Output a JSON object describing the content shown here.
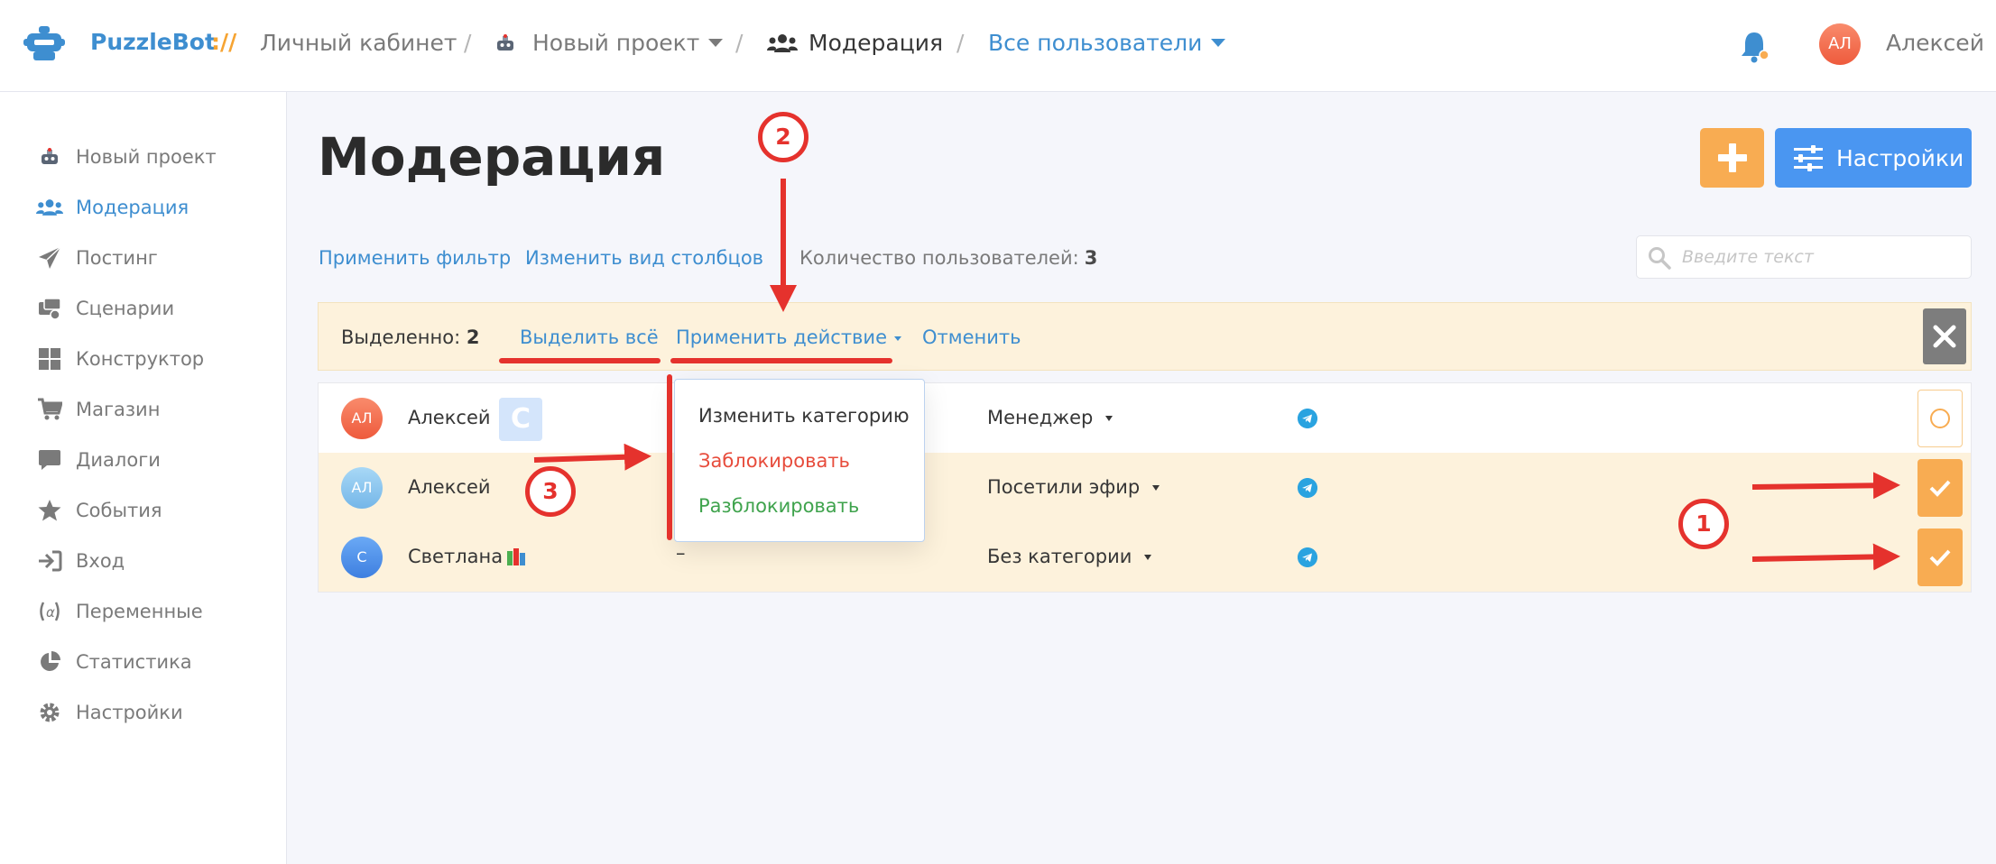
{
  "header": {
    "brand": "PuzzleBot",
    "brand_sep": "://",
    "crumb_cabinet": "Личный кабинет",
    "crumb_project": "Новый проект",
    "crumb_section": "Модерация",
    "crumb_filter": "Все пользователи",
    "user_initials": "АЛ",
    "user_name": "Алексей"
  },
  "sidebar": {
    "items": [
      {
        "label": "Новый проект",
        "icon": "bot-icon"
      },
      {
        "label": "Модерация",
        "icon": "users-icon",
        "active": true
      },
      {
        "label": "Постинг",
        "icon": "paper-plane-icon"
      },
      {
        "label": "Сценарии",
        "icon": "scenario-icon"
      },
      {
        "label": "Конструктор",
        "icon": "grid-icon"
      },
      {
        "label": "Магазин",
        "icon": "cart-icon"
      },
      {
        "label": "Диалоги",
        "icon": "chat-icon"
      },
      {
        "label": "События",
        "icon": "star-icon"
      },
      {
        "label": "Вход",
        "icon": "sign-in-icon"
      },
      {
        "label": "Переменные",
        "icon": "variable-icon"
      },
      {
        "label": "Статистика",
        "icon": "pie-chart-icon"
      },
      {
        "label": "Настройки",
        "icon": "gear-icon"
      }
    ]
  },
  "main": {
    "title": "Модерация",
    "settings_label": "Настройки",
    "apply_filter": "Применить фильтр",
    "change_columns": "Изменить вид столбцов",
    "count_label": "Количество пользователей:",
    "count_value": "3",
    "search_placeholder": "Введите текст"
  },
  "selection": {
    "label": "Выделенно:",
    "count": "2",
    "select_all": "Выделить всё",
    "apply_action": "Применить действие",
    "cancel": "Отменить"
  },
  "dropdown": {
    "change_category": "Изменить категорию",
    "block": "Заблокировать",
    "unblock": "Разблокировать"
  },
  "rows": [
    {
      "initials": "АЛ",
      "name": "Алексей",
      "badge": "C",
      "category": "Менеджер",
      "selected": false
    },
    {
      "initials": "АЛ",
      "name": "Алексей",
      "category": "Посетили эфир",
      "selected": true
    },
    {
      "initials": "С",
      "name": "Светлана",
      "dash": "–",
      "category": "Без категории",
      "selected": true
    }
  ],
  "annotations": {
    "m1": "1",
    "m2": "2",
    "m3": "3"
  },
  "colors": {
    "accent_blue": "#3e8ed0",
    "orange": "#f8ac52",
    "red_annotation": "#e5322d",
    "selection_bg": "#fdf2dc"
  }
}
